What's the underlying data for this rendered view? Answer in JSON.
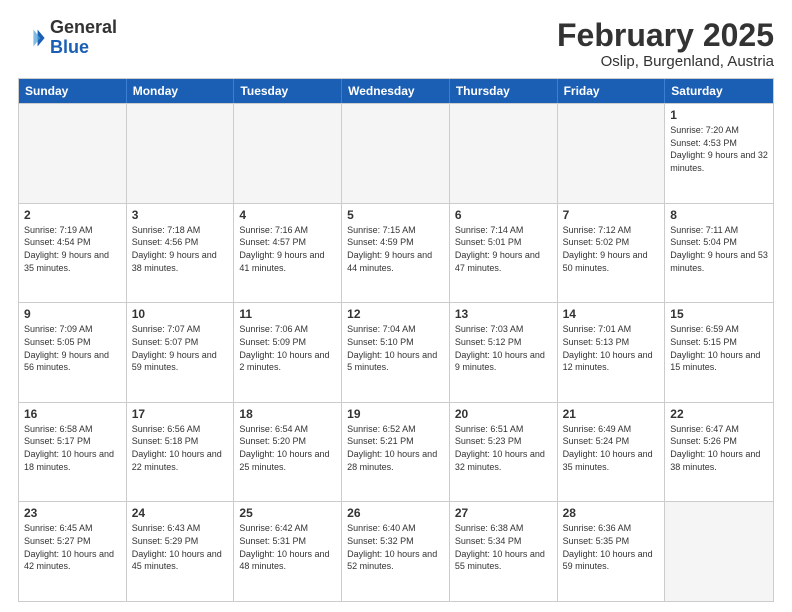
{
  "logo": {
    "general": "General",
    "blue": "Blue"
  },
  "title": "February 2025",
  "subtitle": "Oslip, Burgenland, Austria",
  "days": [
    "Sunday",
    "Monday",
    "Tuesday",
    "Wednesday",
    "Thursday",
    "Friday",
    "Saturday"
  ],
  "weeks": [
    [
      {
        "day": "",
        "empty": true
      },
      {
        "day": "",
        "empty": true
      },
      {
        "day": "",
        "empty": true
      },
      {
        "day": "",
        "empty": true
      },
      {
        "day": "",
        "empty": true
      },
      {
        "day": "",
        "empty": true
      },
      {
        "day": "1",
        "info": "Sunrise: 7:20 AM\nSunset: 4:53 PM\nDaylight: 9 hours and 32 minutes."
      }
    ],
    [
      {
        "day": "2",
        "info": "Sunrise: 7:19 AM\nSunset: 4:54 PM\nDaylight: 9 hours and 35 minutes."
      },
      {
        "day": "3",
        "info": "Sunrise: 7:18 AM\nSunset: 4:56 PM\nDaylight: 9 hours and 38 minutes."
      },
      {
        "day": "4",
        "info": "Sunrise: 7:16 AM\nSunset: 4:57 PM\nDaylight: 9 hours and 41 minutes."
      },
      {
        "day": "5",
        "info": "Sunrise: 7:15 AM\nSunset: 4:59 PM\nDaylight: 9 hours and 44 minutes."
      },
      {
        "day": "6",
        "info": "Sunrise: 7:14 AM\nSunset: 5:01 PM\nDaylight: 9 hours and 47 minutes."
      },
      {
        "day": "7",
        "info": "Sunrise: 7:12 AM\nSunset: 5:02 PM\nDaylight: 9 hours and 50 minutes."
      },
      {
        "day": "8",
        "info": "Sunrise: 7:11 AM\nSunset: 5:04 PM\nDaylight: 9 hours and 53 minutes."
      }
    ],
    [
      {
        "day": "9",
        "info": "Sunrise: 7:09 AM\nSunset: 5:05 PM\nDaylight: 9 hours and 56 minutes."
      },
      {
        "day": "10",
        "info": "Sunrise: 7:07 AM\nSunset: 5:07 PM\nDaylight: 9 hours and 59 minutes."
      },
      {
        "day": "11",
        "info": "Sunrise: 7:06 AM\nSunset: 5:09 PM\nDaylight: 10 hours and 2 minutes."
      },
      {
        "day": "12",
        "info": "Sunrise: 7:04 AM\nSunset: 5:10 PM\nDaylight: 10 hours and 5 minutes."
      },
      {
        "day": "13",
        "info": "Sunrise: 7:03 AM\nSunset: 5:12 PM\nDaylight: 10 hours and 9 minutes."
      },
      {
        "day": "14",
        "info": "Sunrise: 7:01 AM\nSunset: 5:13 PM\nDaylight: 10 hours and 12 minutes."
      },
      {
        "day": "15",
        "info": "Sunrise: 6:59 AM\nSunset: 5:15 PM\nDaylight: 10 hours and 15 minutes."
      }
    ],
    [
      {
        "day": "16",
        "info": "Sunrise: 6:58 AM\nSunset: 5:17 PM\nDaylight: 10 hours and 18 minutes."
      },
      {
        "day": "17",
        "info": "Sunrise: 6:56 AM\nSunset: 5:18 PM\nDaylight: 10 hours and 22 minutes."
      },
      {
        "day": "18",
        "info": "Sunrise: 6:54 AM\nSunset: 5:20 PM\nDaylight: 10 hours and 25 minutes."
      },
      {
        "day": "19",
        "info": "Sunrise: 6:52 AM\nSunset: 5:21 PM\nDaylight: 10 hours and 28 minutes."
      },
      {
        "day": "20",
        "info": "Sunrise: 6:51 AM\nSunset: 5:23 PM\nDaylight: 10 hours and 32 minutes."
      },
      {
        "day": "21",
        "info": "Sunrise: 6:49 AM\nSunset: 5:24 PM\nDaylight: 10 hours and 35 minutes."
      },
      {
        "day": "22",
        "info": "Sunrise: 6:47 AM\nSunset: 5:26 PM\nDaylight: 10 hours and 38 minutes."
      }
    ],
    [
      {
        "day": "23",
        "info": "Sunrise: 6:45 AM\nSunset: 5:27 PM\nDaylight: 10 hours and 42 minutes."
      },
      {
        "day": "24",
        "info": "Sunrise: 6:43 AM\nSunset: 5:29 PM\nDaylight: 10 hours and 45 minutes."
      },
      {
        "day": "25",
        "info": "Sunrise: 6:42 AM\nSunset: 5:31 PM\nDaylight: 10 hours and 48 minutes."
      },
      {
        "day": "26",
        "info": "Sunrise: 6:40 AM\nSunset: 5:32 PM\nDaylight: 10 hours and 52 minutes."
      },
      {
        "day": "27",
        "info": "Sunrise: 6:38 AM\nSunset: 5:34 PM\nDaylight: 10 hours and 55 minutes."
      },
      {
        "day": "28",
        "info": "Sunrise: 6:36 AM\nSunset: 5:35 PM\nDaylight: 10 hours and 59 minutes."
      },
      {
        "day": "",
        "empty": true
      }
    ]
  ]
}
